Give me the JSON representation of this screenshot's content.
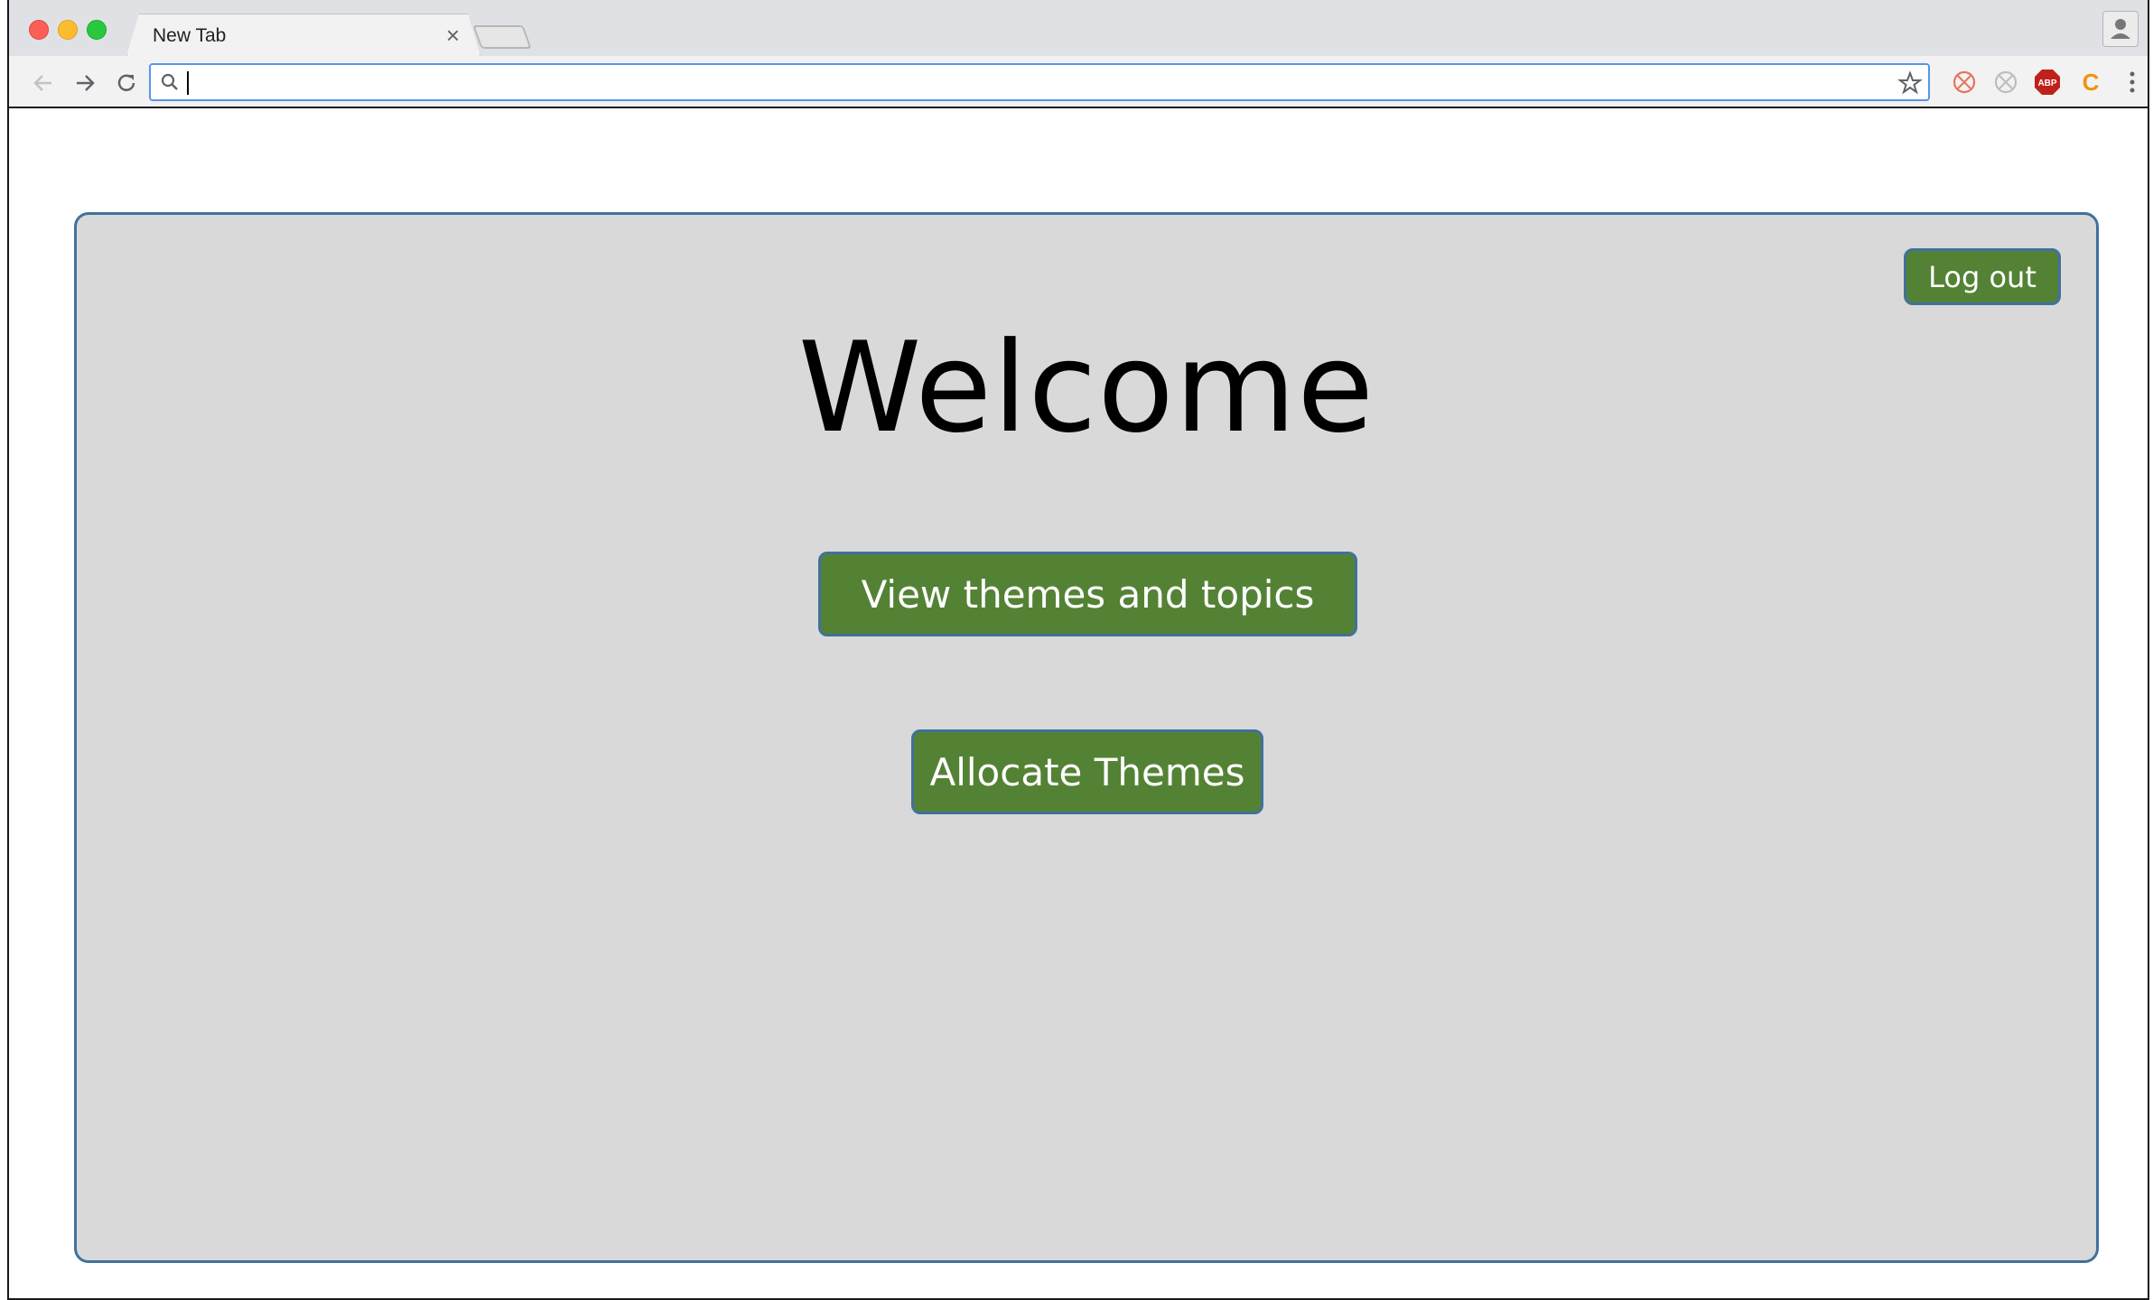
{
  "browser": {
    "tab_title": "New Tab",
    "tab_close": "×",
    "address_value": "",
    "icons": [
      "back-icon",
      "forward-icon",
      "reload-icon",
      "search-icon",
      "star-icon",
      "extension-icon",
      "adblock-icon",
      "menu-icon",
      "profile-icon"
    ],
    "extensions": {
      "abp_label": "ABP",
      "c_label": "C"
    }
  },
  "page": {
    "logout_label": "Log out",
    "welcome_title": "Welcome",
    "view_button_label": "View themes and topics",
    "allocate_button_label": "Allocate Themes"
  },
  "colors": {
    "panel_bg": "#d9d9d9",
    "panel_border": "#41719c",
    "button_bg": "#548235",
    "button_text": "#ffffff"
  }
}
